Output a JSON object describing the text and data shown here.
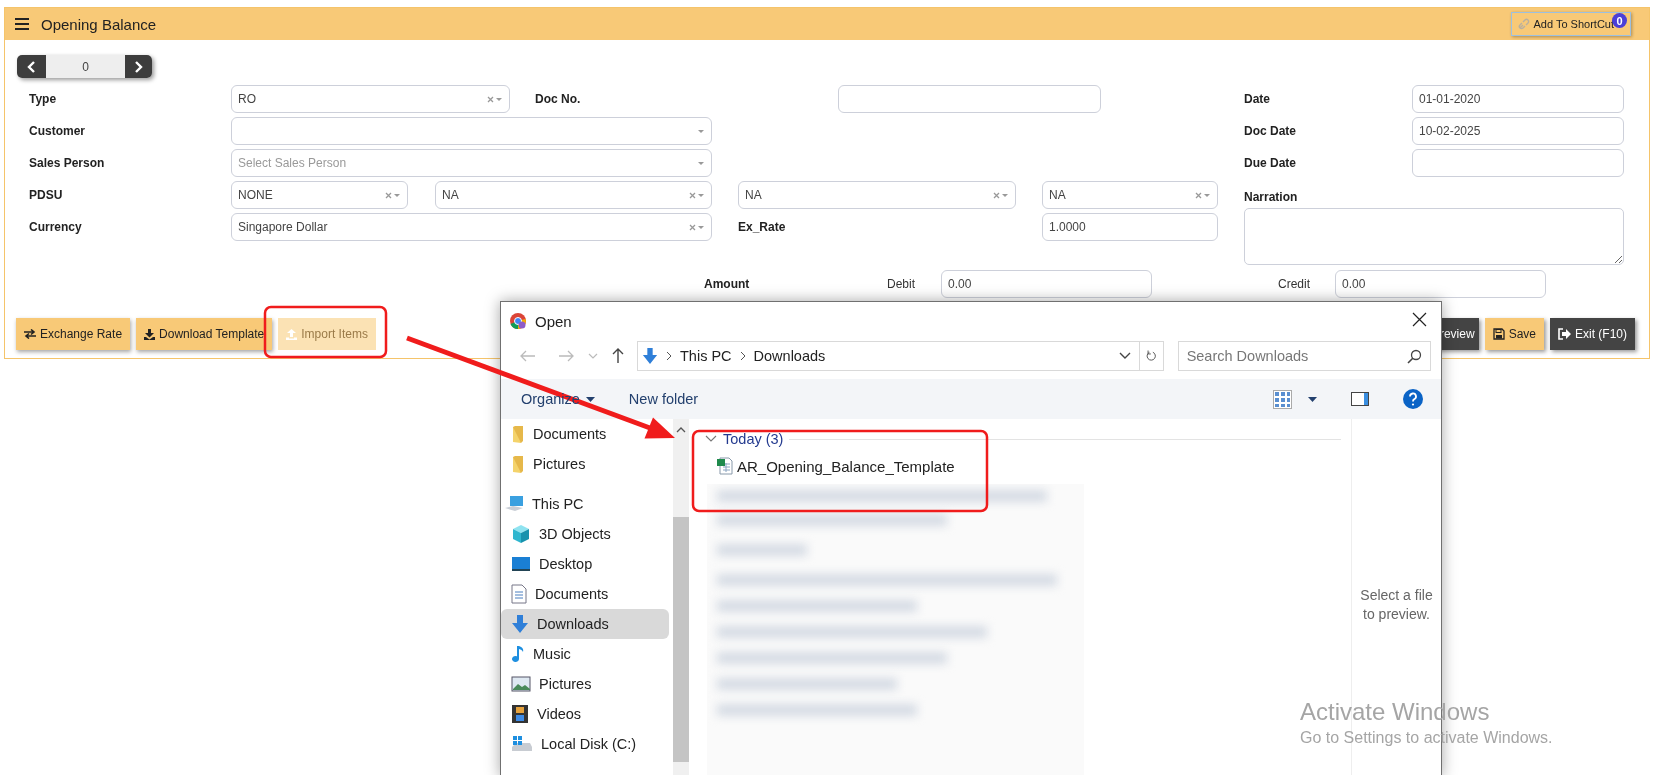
{
  "header": {
    "title": "Opening Balance",
    "shortcut_label": "Add To ShortCut",
    "shortcut_count": "0"
  },
  "pager": {
    "value": "0"
  },
  "form": {
    "type": {
      "label": "Type",
      "select": {
        "value": "RO",
        "clearable": true
      }
    },
    "doc_no": {
      "label": "Doc No."
    },
    "customer": {
      "label": "Customer",
      "select": {
        "clearable": false
      }
    },
    "sales_person": {
      "label": "Sales Person",
      "select": {
        "placeholder": "Select Sales Person",
        "clearable": false
      }
    },
    "pdsu": {
      "label": "PDSU",
      "selects": [
        {
          "value": "NONE",
          "clearable": true
        },
        {
          "value": "NA",
          "clearable": true
        },
        {
          "value": "NA",
          "clearable": true
        },
        {
          "value": "NA",
          "clearable": true
        }
      ]
    },
    "currency": {
      "label": "Currency",
      "select": {
        "value": "Singapore Dollar",
        "clearable": true
      }
    },
    "ex_rate": {
      "label": "Ex_Rate",
      "value": "1.0000"
    },
    "date": {
      "label": "Date",
      "value": "01-01-2020"
    },
    "doc_date": {
      "label": "Doc Date",
      "value": "10-02-2025"
    },
    "due_date": {
      "label": "Due Date"
    },
    "narration": {
      "label": "Narration"
    },
    "amount": {
      "label": "Amount",
      "debit_label": "Debit",
      "debit_value": "0.00",
      "credit_label": "Credit",
      "credit_value": "0.00"
    }
  },
  "action_buttons": [
    {
      "label": "Exchange Rate",
      "kind": "exchange",
      "disabled": false
    },
    {
      "label": "Download Template",
      "kind": "download",
      "disabled": false
    },
    {
      "label": "Import Items",
      "kind": "upload",
      "disabled": true
    }
  ],
  "right_buttons": [
    {
      "label": "review",
      "kind": "preview"
    },
    {
      "label": "Save",
      "kind": "save"
    },
    {
      "label": "Exit (F10)",
      "kind": "exit"
    }
  ],
  "dialog": {
    "title": "Open",
    "path": [
      "This PC",
      "Downloads"
    ],
    "search_placeholder": "Search Downloads",
    "organize": "Organize",
    "new_folder": "New folder",
    "quick_access": [
      {
        "label": "Documents",
        "kind": "folder",
        "selected": false
      },
      {
        "label": "Pictures",
        "kind": "folder",
        "selected": false
      }
    ],
    "tree": [
      {
        "label": "This PC",
        "kind": "pc",
        "selected": false,
        "children": [
          {
            "label": "3D Objects",
            "kind": "cube",
            "selected": false
          },
          {
            "label": "Desktop",
            "kind": "desktop",
            "selected": false
          },
          {
            "label": "Documents",
            "kind": "documents",
            "selected": false
          },
          {
            "label": "Downloads",
            "kind": "downloads",
            "selected": true
          },
          {
            "label": "Music",
            "kind": "music",
            "selected": false
          },
          {
            "label": "Pictures",
            "kind": "pictures",
            "selected": false
          },
          {
            "label": "Videos",
            "kind": "videos",
            "selected": false
          },
          {
            "label": "Local Disk (C:)",
            "kind": "disk",
            "selected": false
          }
        ]
      }
    ],
    "groups": [
      {
        "label": "Today (3)",
        "expanded": true,
        "files": [
          {
            "name": "AR_Opening_Balance_Template",
            "kind": "spreadsheet"
          }
        ]
      }
    ],
    "preview_hint": "Select a file to preview."
  },
  "activation": {
    "title": "Activate Windows",
    "message": "Go to Settings to activate Windows."
  }
}
